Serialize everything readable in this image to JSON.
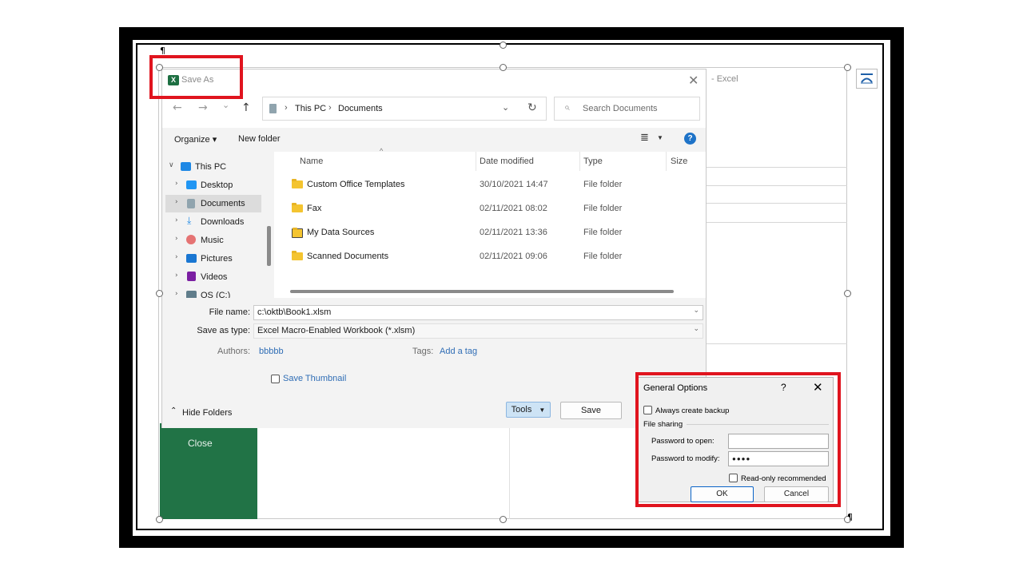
{
  "background": {
    "excel_suffix": "- Excel",
    "close_label": "Close",
    "pilcrow": "¶"
  },
  "save_dialog": {
    "title": "Save As",
    "nav": {
      "back": "←",
      "forward": "→",
      "recent": "⌄",
      "up": "↑"
    },
    "breadcrumb": [
      "This PC",
      "Documents"
    ],
    "search_placeholder": "Search Documents",
    "toolbar": {
      "organize": "Organize",
      "new_folder": "New folder"
    },
    "tree": [
      {
        "label": "This PC",
        "icon": "pc-icon",
        "color": "#1e88e5"
      },
      {
        "label": "Desktop",
        "icon": "desktop-icon",
        "color": "#2196f3"
      },
      {
        "label": "Documents",
        "icon": "documents-icon",
        "color": "#90a4ae"
      },
      {
        "label": "Downloads",
        "icon": "downloads-icon",
        "color": "#1e88e5"
      },
      {
        "label": "Music",
        "icon": "music-icon",
        "color": "#e57373"
      },
      {
        "label": "Pictures",
        "icon": "pictures-icon",
        "color": "#1976d2"
      },
      {
        "label": "Videos",
        "icon": "videos-icon",
        "color": "#7b1fa2"
      },
      {
        "label": "OS (C:)",
        "icon": "drive-icon",
        "color": "#607d8b"
      }
    ],
    "columns": [
      "Name",
      "Date modified",
      "Type",
      "Size"
    ],
    "files": [
      {
        "name": "Custom Office Templates",
        "date": "30/10/2021 14:47",
        "type": "File folder"
      },
      {
        "name": "Fax",
        "date": "02/11/2021 08:02",
        "type": "File folder"
      },
      {
        "name": "My Data Sources",
        "date": "02/11/2021 13:36",
        "type": "File folder"
      },
      {
        "name": "Scanned Documents",
        "date": "02/11/2021 09:06",
        "type": "File folder"
      }
    ],
    "file_name_label": "File name:",
    "file_name_value": "c:\\oktb\\Book1.xlsm",
    "save_type_label": "Save as type:",
    "save_type_value": "Excel Macro-Enabled Workbook (*.xlsm)",
    "authors_label": "Authors:",
    "authors_value": "bbbbb",
    "tags_label": "Tags:",
    "tags_value": "Add a tag",
    "save_thumbnail": "Save Thumbnail",
    "hide_folders": "Hide Folders",
    "tools": "Tools",
    "save": "Save"
  },
  "general_options": {
    "title": "General Options",
    "help": "?",
    "close": "✕",
    "always_backup": "Always create backup",
    "file_sharing": "File sharing",
    "password_open_label": "Password to open:",
    "password_open_value": "",
    "password_modify_label": "Password to modify:",
    "password_modify_value": "●●●●",
    "read_only": "Read-only recommended",
    "ok": "OK",
    "cancel": "Cancel"
  },
  "colors": {
    "highlight_red": "#e0141e",
    "excel_green": "#217346",
    "link_blue": "#2f6db5"
  }
}
